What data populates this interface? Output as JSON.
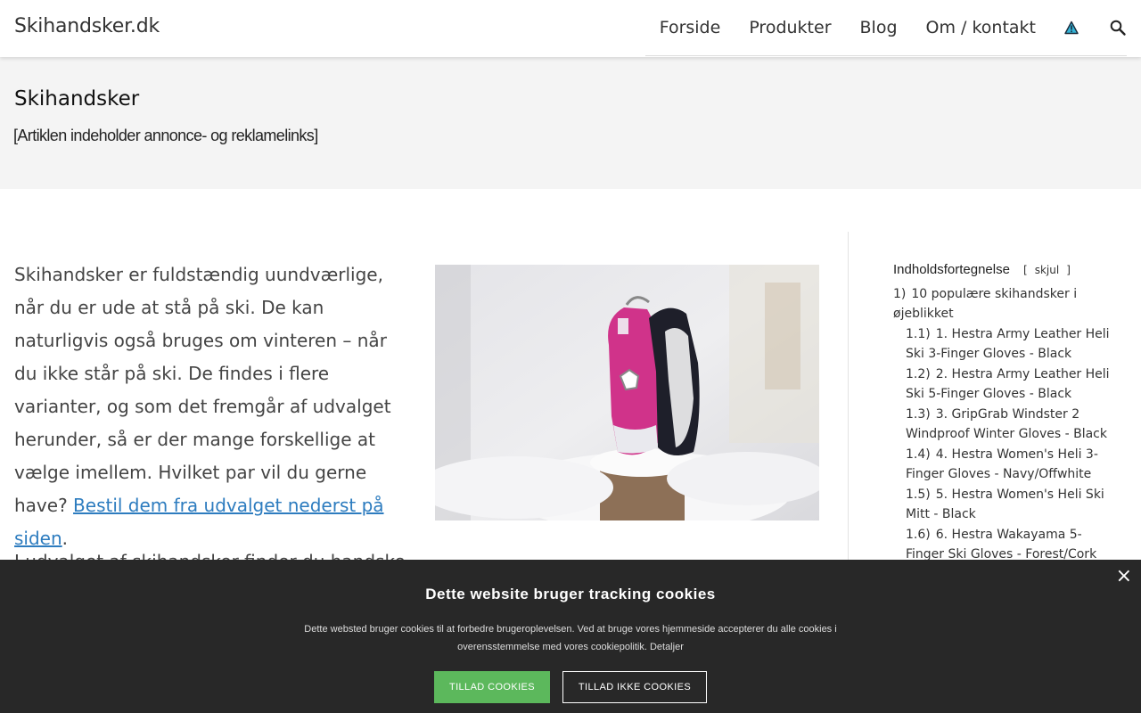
{
  "header": {
    "logo": "Skihandsker.dk",
    "nav": [
      "Forside",
      "Produkter",
      "Blog",
      "Om / kontakt"
    ]
  },
  "hero": {
    "title": "Skihandsker",
    "disclaimer": "[Artiklen indeholder annonce- og reklamelinks]"
  },
  "article": {
    "intro": "Skihandsker er fuldstændig uundværlige, når du er ude at stå på ski. De kan naturligvis også bruges om vinteren – når du ikke står på ski. De findes i flere varianter, og som det fremgår af udvalget herunder, så er der mange forskellige at vælge imellem. Hvilket par vil du gerne have? ",
    "link_text": "Bestil dem fra udvalget nederst på siden",
    "after_link": ".",
    "second_paragraph": "I udvalget af skihandsker finder du handsker til"
  },
  "toc": {
    "title": "Indholdsfortegnelse",
    "toggle_open": "[",
    "toggle_label": "skjul",
    "toggle_close": "]",
    "items": [
      {
        "num": "1)",
        "text": "10 populære skihandsker i øjeblikket",
        "sub": false
      },
      {
        "num": "1.1)",
        "text": "1. Hestra Army Leather Heli Ski 3-Finger Gloves - Black",
        "sub": true
      },
      {
        "num": "1.2)",
        "text": "2. Hestra Army Leather Heli Ski 5-Finger Gloves - Black",
        "sub": true
      },
      {
        "num": "1.3)",
        "text": "3. GripGrab Windster 2 Windproof Winter Gloves - Black",
        "sub": true
      },
      {
        "num": "1.4)",
        "text": "4. Hestra Women's Heli 3-Finger Gloves - Navy/Offwhite",
        "sub": true
      },
      {
        "num": "1.5)",
        "text": "5. Hestra Women's Heli Ski Mitt - Black",
        "sub": true
      },
      {
        "num": "1.6)",
        "text": "6. Hestra Wakayama 5-Finger Ski Gloves - Forest/Cork",
        "sub": true
      }
    ]
  },
  "cookie": {
    "close": "×",
    "title": "Dette website bruger tracking cookies",
    "text": "Dette websted bruger cookies til at forbedre brugeroplevelsen. Ved at bruge vores hjemmeside accepterer du alle cookies i overensstemmelse med vores cookiepolitik. Detaljer",
    "allow": "TILLAD COOKIES",
    "deny": "TILLAD IKKE COOKIES"
  },
  "colors": {
    "link": "#2d7cbf",
    "cookie_bg": "#282828",
    "allow_btn": "#5cb85c",
    "hero_bg": "#f4f4f4"
  }
}
